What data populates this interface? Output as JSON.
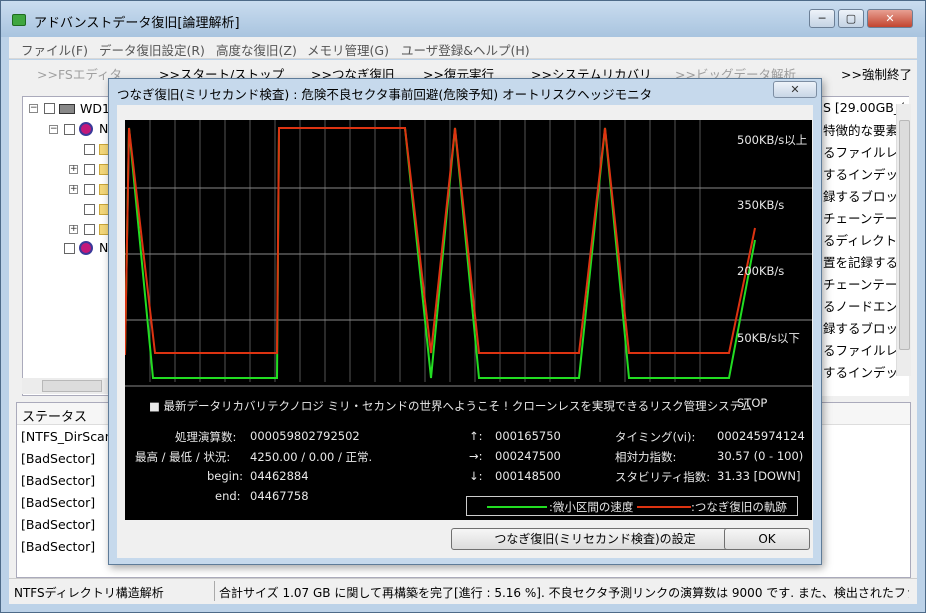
{
  "app": {
    "title": "アドバンストデータ復旧[論理解析]",
    "window_buttons": {
      "minimize": "─",
      "maximize": "▢",
      "close": "✕"
    }
  },
  "menu": [
    "ファイル(F)",
    "データ復旧設定(R)",
    "高度な復旧(Z)",
    "メモリ管理(G)",
    "ユーザ登録&ヘルプ(H)"
  ],
  "toolbar": [
    {
      "label": ">>FSエディタ",
      "enabled": false
    },
    {
      "label": ">>スタート/ストップ",
      "enabled": true
    },
    {
      "label": ">>つなぎ復旧",
      "enabled": true
    },
    {
      "label": ">>復元実行",
      "enabled": true
    },
    {
      "label": ">>システムリカバリ",
      "enabled": true
    },
    {
      "label": ">>ビッグデータ解析",
      "enabled": false
    },
    {
      "label": ">>強制終了",
      "enabled": true
    }
  ],
  "tree": {
    "root_label": "WD1",
    "child_label": "NT",
    "second_label": "N"
  },
  "right_list": {
    "header": "S [29.00GB_(",
    "items": [
      "特徴的な要素",
      "るファイルレ",
      "するインデッ",
      "録するブロッ",
      "チェーンテー",
      "るディレクト",
      "置を記録する",
      "チェーンテー",
      "るノードエン",
      "録するブロッ",
      "るファイルレ",
      "するインデッ"
    ]
  },
  "status": {
    "header": "ステータス",
    "rows": [
      "[NTFS_DirScan",
      "[BadSector]",
      "[BadSector]",
      "[BadSector]",
      "[BadSector]",
      "[BadSector]"
    ]
  },
  "statusbar": {
    "left": "NTFSディレクトリ構造解析",
    "right": "合計サイズ 1.07 GB に関して再構築を完了[進行 : 5.16 %]. 不良セクタ予測リンクの演算数は 9000 です. また、検出されたファ"
  },
  "dialog": {
    "title": "つなぎ復旧(ミリセカンド検査) : 危険不良セクタ事前回避(危険予知) オートリスクヘッジモニタ",
    "close": "✕",
    "levels": [
      "500KB/s以上",
      "350KB/s",
      "200KB/s",
      "50KB/s以下",
      "STOP"
    ],
    "message": "■ 最新データリカバリテクノロジ ミリ・セカンドの世界へようこそ ! クローンレスを実現できるリスク管理システム",
    "stats_left": [
      {
        "label": "処理演算数:",
        "value": "000059802792502"
      },
      {
        "label": "最高 / 最低 / 状況:",
        "value": "4250.00 / 0.00 / 正常."
      },
      {
        "label": "begin:",
        "value": "04462884"
      },
      {
        "label": "end:",
        "value": "04467758"
      }
    ],
    "stats_mid": [
      {
        "label": "↑:",
        "value": "000165750"
      },
      {
        "label": "→:",
        "value": "000247500"
      },
      {
        "label": "↓:",
        "value": "000148500"
      }
    ],
    "stats_right": [
      {
        "label": "タイミング(vi):",
        "value": "000245974124"
      },
      {
        "label": "相対力指数:",
        "value": "30.57 (0 - 100)"
      },
      {
        "label": "スタビリティ指数:",
        "value": "31.33 [DOWN]"
      }
    ],
    "legend": [
      {
        "label": ":微小区間の速度",
        "color": "#22dd22"
      },
      {
        "label": ":つなぎ復旧の軌跡",
        "color": "#dd3311"
      }
    ],
    "buttons": {
      "settings": "つなぎ復旧(ミリセカンド検査)の設定",
      "ok": "OK"
    }
  },
  "colors": {
    "green_line": "#22dd22",
    "red_line": "#dd3311",
    "grid": "#555555",
    "background": "#000000"
  }
}
